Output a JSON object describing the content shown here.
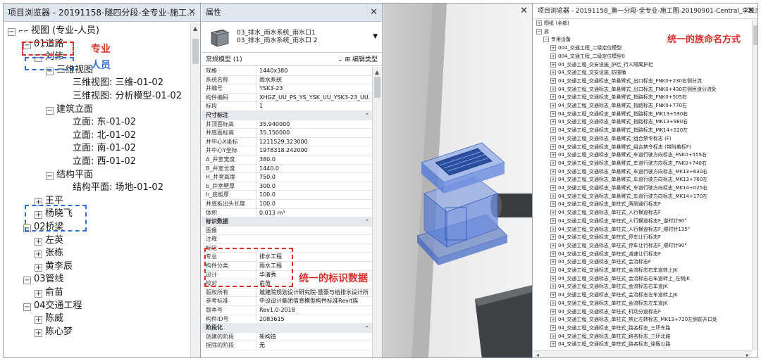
{
  "project_browser": {
    "title": "项目浏览器 - 20191158-隧四分段-全专业-施工...",
    "close": "✕",
    "tree": [
      {
        "label": "视图 (专业-人员)",
        "depth": 0,
        "toggle": "−",
        "icon": "views-icon"
      },
      {
        "label": "01道路",
        "depth": 1,
        "toggle": "−"
      },
      {
        "label": "刘伟",
        "depth": 2,
        "toggle": "−"
      },
      {
        "label": "三维视图",
        "depth": 3,
        "toggle": "−"
      },
      {
        "label": "三维视图: 三维-01-02",
        "depth": 4,
        "toggle": ""
      },
      {
        "label": "三维视图: 分析模型-01-02",
        "depth": 4,
        "toggle": ""
      },
      {
        "label": "建筑立面",
        "depth": 3,
        "toggle": "−"
      },
      {
        "label": "立面: 东-01-02",
        "depth": 4,
        "toggle": ""
      },
      {
        "label": "立面: 北-01-02",
        "depth": 4,
        "toggle": ""
      },
      {
        "label": "立面: 南-01-02",
        "depth": 4,
        "toggle": ""
      },
      {
        "label": "立面: 西-01-02",
        "depth": 4,
        "toggle": ""
      },
      {
        "label": "结构平面",
        "depth": 3,
        "toggle": "−"
      },
      {
        "label": "结构平面: 场地-01-02",
        "depth": 4,
        "toggle": ""
      },
      {
        "label": "王平",
        "depth": 2,
        "toggle": "+"
      },
      {
        "label": "杨晓飞",
        "depth": 2,
        "toggle": "+"
      },
      {
        "label": "02桥梁",
        "depth": 1,
        "toggle": "−"
      },
      {
        "label": "左英",
        "depth": 2,
        "toggle": "+"
      },
      {
        "label": "张栋",
        "depth": 2,
        "toggle": "+"
      },
      {
        "label": "黄李辰",
        "depth": 2,
        "toggle": "+"
      },
      {
        "label": "03管线",
        "depth": 1,
        "toggle": "−"
      },
      {
        "label": "俞苗",
        "depth": 2,
        "toggle": "+"
      },
      {
        "label": "04交通工程",
        "depth": 1,
        "toggle": "−"
      },
      {
        "label": "陈威",
        "depth": 2,
        "toggle": "+"
      },
      {
        "label": "陈心梦",
        "depth": 2,
        "toggle": "+"
      }
    ],
    "annotation_major": "专业",
    "annotation_person": "人员"
  },
  "properties": {
    "title": "属性",
    "close": "✕",
    "type_name_line1": "03_排水_雨水系统_雨水口1",
    "type_name_line2": "03_排水_雨水系统_雨水口 2",
    "filter": "常规模型 (1)",
    "edit_type": "编辑类型",
    "rows": [
      {
        "k": "规格",
        "v": "1440x380"
      },
      {
        "k": "系统名称",
        "v": "雨水系统"
      },
      {
        "k": "井编号",
        "v": "YSK3-23"
      },
      {
        "k": "构件编码",
        "v": "XHGZ_UU_PS_YS_YSK_UU_YSK3-23_UU..."
      },
      {
        "k": "标段",
        "v": "1"
      },
      {
        "k": "尺寸标注",
        "v": "",
        "group": true
      },
      {
        "k": "井顶面标高",
        "v": "35.940000"
      },
      {
        "k": "井底面标高",
        "v": "35.150000"
      },
      {
        "k": "井中心X坐标",
        "v": "1211529.323000"
      },
      {
        "k": "井中心Y坐标",
        "v": "1978318.242000"
      },
      {
        "k": "A_井室宽度",
        "v": "380.0"
      },
      {
        "k": "B_井室长度",
        "v": "1440.0"
      },
      {
        "k": "H_井室高度",
        "v": "750.0"
      },
      {
        "k": "b_井室壁厚",
        "v": "300.0"
      },
      {
        "k": "h_底板厚",
        "v": "100.0"
      },
      {
        "k": "井底板出头长度",
        "v": "100.0"
      },
      {
        "k": "体积",
        "v": "0.013 m³"
      },
      {
        "k": "标识数据",
        "v": "",
        "group": true
      },
      {
        "k": "图像",
        "v": ""
      },
      {
        "k": "注释",
        "v": ""
      },
      {
        "k": "标记",
        "v": ""
      },
      {
        "k": "专业",
        "v": "排水工程"
      },
      {
        "k": "构件分类",
        "v": "雨水工程"
      },
      {
        "k": "设计",
        "v": "华清秀"
      },
      {
        "k": "校对",
        "v": "俞苗"
      },
      {
        "k": "版权所有",
        "v": "城建院规划设计研究院-暨豪与给排水设计所"
      },
      {
        "k": "参考标准",
        "v": "中设设计集团信息模型构件标准Revit族"
      },
      {
        "k": "版本号",
        "v": "Rev1.0-2018"
      },
      {
        "k": "构件ID号",
        "v": "2083615"
      },
      {
        "k": "阶段化",
        "v": "",
        "group": true
      },
      {
        "k": "创建的阶段",
        "v": "新构造"
      },
      {
        "k": "拆除的阶段",
        "v": "无"
      }
    ],
    "annotation": "统一的标识数据"
  },
  "view3d": {
    "close": "✕"
  },
  "family_browser": {
    "title": "项目浏览器 - 20191158_第一分段-全专业-施工图-20190901-Central_李亚杰",
    "close": "✕",
    "annotation": "统一的族命名方式",
    "tree": [
      {
        "label": "图纸 (全部)",
        "depth": 0,
        "toggle": "+"
      },
      {
        "label": "族",
        "depth": 0,
        "toggle": "−"
      },
      {
        "label": "专用设备",
        "depth": 1,
        "toggle": "−"
      },
      {
        "label": "004_交通工程_二级定位模型",
        "depth": 2,
        "toggle": "+"
      },
      {
        "label": "004_交通工程_二级定位模型0",
        "depth": 2,
        "toggle": "+"
      },
      {
        "label": "04_交通工程_交安设施_护栏_行人隔离护栏",
        "depth": 2,
        "toggle": "+"
      },
      {
        "label": "04_交通工程_交安设施_防撞桶",
        "depth": 2,
        "toggle": "+"
      },
      {
        "label": "04_交通工程_交通标志_单悬臂式_出口标志_FNK0+230右侧分流",
        "depth": 2,
        "toggle": "+"
      },
      {
        "label": "04_交通工程_交通标志_单悬臂式_出口标志_FNK0+430右侧匝道分流处",
        "depth": 2,
        "toggle": "+"
      },
      {
        "label": "04_交通工程_交通标志_单悬臂式_指路标志_FNK0+505右",
        "depth": 2,
        "toggle": "+"
      },
      {
        "label": "04_交通工程_交通标志_单悬臂式_指路标志_FNK0+770右",
        "depth": 2,
        "toggle": "+"
      },
      {
        "label": "04_交通工程_交通标志_单悬臂式_指路标志_MK13+590右",
        "depth": 2,
        "toggle": "+"
      },
      {
        "label": "04_交通工程_交通标志_单悬臂式_指路标志_MK13+980右",
        "depth": 2,
        "toggle": "+"
      },
      {
        "label": "04_交通工程_交通标志_单悬臂式_指路标志_MK14+220左",
        "depth": 2,
        "toggle": "+"
      },
      {
        "label": "04_交通工程_交通标志_单悬臂式_组合禁令标志 (F)",
        "depth": 2,
        "toggle": "+"
      },
      {
        "label": "04_交通工程_交通标志_单悬臂式_组合禁令标志 (带附着标F)",
        "depth": 2,
        "toggle": "+"
      },
      {
        "label": "04_交通工程_交通标志_单悬臂式_车道行驶方向标志_FNK0+555右",
        "depth": 2,
        "toggle": "+"
      },
      {
        "label": "04_交通工程_交通标志_单悬臂式_车道行驶方向标志_FNK0+740右",
        "depth": 2,
        "toggle": "+"
      },
      {
        "label": "04_交通工程_交通标志_单悬臂式_车道行驶方向标志_MK13+630右",
        "depth": 2,
        "toggle": "+"
      },
      {
        "label": "04_交通工程_交通标志_单悬臂式_车道行驶方向标志_MK13+760左",
        "depth": 2,
        "toggle": "+"
      },
      {
        "label": "04_交通工程_交通标志_单悬臂式_车道行驶方向标志_MK14+025右",
        "depth": 2,
        "toggle": "+"
      },
      {
        "label": "04_交通工程_交通标志_单悬臂式_车道行驶方向标志_MK14+170左",
        "depth": 2,
        "toggle": "+"
      },
      {
        "label": "04_交通工程_交通标志_单柱式_两侧通行标志F",
        "depth": 2,
        "toggle": "+"
      },
      {
        "label": "04_交通工程_交通标志_单柱式_人行横道标志F",
        "depth": 2,
        "toggle": "+"
      },
      {
        "label": "04_交通工程_交通标志_单柱式_人行横道标志F_逆时针90°",
        "depth": 2,
        "toggle": "+"
      },
      {
        "label": "04_交通工程_交通标志_单柱式_人行横道标志F_顺时针135°",
        "depth": 2,
        "toggle": "+"
      },
      {
        "label": "04_交通工程_交通标志_单柱式_停车让行标志F",
        "depth": 2,
        "toggle": "+"
      },
      {
        "label": "04_交通工程_交通标志_单柱式_停车让行标志F_顺时针90°",
        "depth": 2,
        "toggle": "+"
      },
      {
        "label": "04_交通工程_交通标志_单柱式_减速让行标志F",
        "depth": 2,
        "toggle": "+"
      },
      {
        "label": "04_交通工程_交通标志_单柱式_会流标志F",
        "depth": 2,
        "toggle": "+"
      },
      {
        "label": "04_交通工程_交通标志_单柱式_会流标志右车道转上JK",
        "depth": 2,
        "toggle": "+"
      },
      {
        "label": "04_交通工程_交通标志_单柱式_会流标志右车道转上_左侧JK",
        "depth": 2,
        "toggle": "+"
      },
      {
        "label": "04_交通工程_交通标志_单柱式_会流标志右车道JK",
        "depth": 2,
        "toggle": "+"
      },
      {
        "label": "04_交通工程_交通标志_单柱式_会流标志左车道转上JK",
        "depth": 2,
        "toggle": "+"
      },
      {
        "label": "04_交通工程_交通标志_单柱式_会流标志左车道JK",
        "depth": 2,
        "toggle": "+"
      },
      {
        "label": "04_交通工程_交通标志_单柱式_机动分道标志F",
        "depth": 2,
        "toggle": "+"
      },
      {
        "label": "04_交通工程_交通标志_单柱式_禁止左转标志_MK13+720左侧前开口处",
        "depth": 2,
        "toggle": "+"
      },
      {
        "label": "04_交通工程_交通标志_单柱式_路名标志_三环东路",
        "depth": 2,
        "toggle": "+"
      },
      {
        "label": "04_交通工程_交通标志_单柱式_路名标志_三环北路",
        "depth": 2,
        "toggle": "+"
      },
      {
        "label": "04_交通工程_交通标志_单柱式_路名标志_徐畈公路",
        "depth": 2,
        "toggle": "+"
      }
    ],
    "scroll_left": "◂",
    "scroll_right": "▸"
  }
}
